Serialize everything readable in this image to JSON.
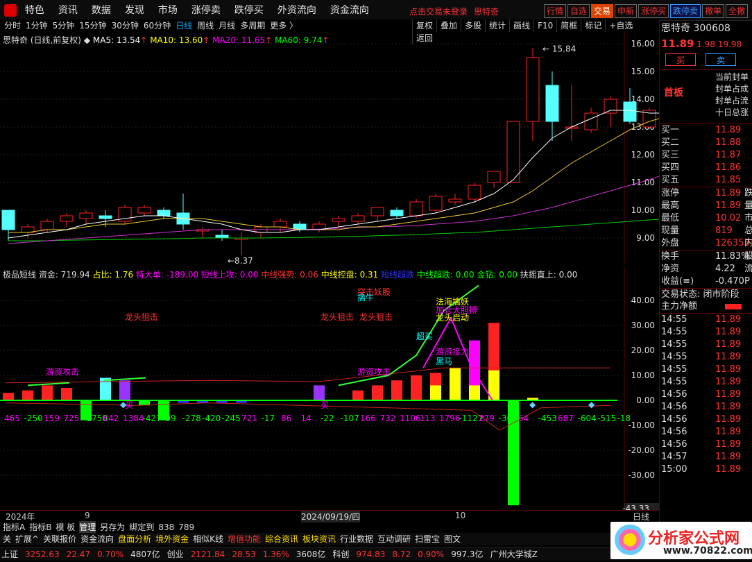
{
  "menu": [
    "特色",
    "资讯",
    "数据",
    "发现",
    "市场",
    "涨停卖",
    "跌停买",
    "外资流向",
    "资金流向"
  ],
  "topRight": {
    "login": "点击交易未登录",
    "stock": "思特奇",
    "buttons": [
      "行情",
      "自选",
      "交易",
      "申新",
      "涨停买",
      "跌停卖",
      "撤单",
      "全撤"
    ]
  },
  "periods": [
    "分时",
    "1分钟",
    "5分钟",
    "15分钟",
    "30分钟",
    "60分钟",
    "日线",
    "周线",
    "月线",
    "多周期",
    "更多 〉"
  ],
  "activePeriod": "日线",
  "tools": [
    "复权",
    "叠加",
    "多股",
    "统计",
    "画线",
    "F10",
    "简框",
    "标记",
    "+自选",
    "返回"
  ],
  "main": {
    "title": "思特奇 (日线,前复权)",
    "ma5": "MA5: 13.54",
    "ma10": "MA10: 13.60",
    "ma20": "MA20: 11.65",
    "ma60": "MA60: 9.74",
    "high": "15.84",
    "low": "8.37",
    "yticks": [
      "16.00",
      "15.00",
      "14.00",
      "13.00",
      "12.00",
      "11.00",
      "10.00",
      "9.00"
    ]
  },
  "sub": {
    "name": "极品短线",
    "indicators": [
      {
        "t": "资金: 719.94",
        "c": "#ddd"
      },
      {
        "t": "占比: 1.76",
        "c": "#ff0"
      },
      {
        "t": "特大单: -189.00",
        "c": "#f0f"
      },
      {
        "t": "短线上攻: 0.00",
        "c": "#f0f"
      },
      {
        "t": "中线强势: 0.06",
        "c": "#f33"
      },
      {
        "t": "中线控盘: 0.31",
        "c": "#ff0"
      },
      {
        "t": "短线超跌",
        "c": "#33f"
      },
      {
        "t": "中线超跌: 0.00",
        "c": "#0f0"
      },
      {
        "t": "金钻: 0.00",
        "c": "#0f0"
      },
      {
        "t": "扶摇直上: 0.00",
        "c": "#ddd"
      }
    ],
    "yticks": [
      "40.00",
      "30.00",
      "20.00",
      "10.00",
      "0.00",
      "-10.00",
      "-20.00",
      "-30.00"
    ],
    "minLabel": "-43.33",
    "labels": [
      {
        "t": "龙头狙击",
        "x": 180,
        "y": 76,
        "c": "#f33"
      },
      {
        "t": "龙头狙击",
        "x": 462,
        "y": 76,
        "c": "#f33"
      },
      {
        "t": "龙头狙击",
        "x": 518,
        "y": 76,
        "c": "#f33"
      },
      {
        "t": "突击妖股",
        "x": 515,
        "y": 40,
        "c": "#f33"
      },
      {
        "t": "擒牛",
        "x": 515,
        "y": 48,
        "c": "#0ff"
      },
      {
        "t": "法海擒妖",
        "x": 628,
        "y": 54,
        "c": "#ff0"
      },
      {
        "t": "加仓大胆搏",
        "x": 628,
        "y": 66,
        "c": "#f0f"
      },
      {
        "t": "龙头启动",
        "x": 628,
        "y": 77,
        "c": "#ff0"
      },
      {
        "t": "超买",
        "x": 600,
        "y": 104,
        "c": "#0ff"
      },
      {
        "t": "游资接力",
        "x": 628,
        "y": 126,
        "c": "#f0f"
      },
      {
        "t": "黑马",
        "x": 628,
        "y": 140,
        "c": "#0ff"
      },
      {
        "t": "游资攻击",
        "x": 66,
        "y": 155,
        "c": "#f0f"
      },
      {
        "t": "游资攻击",
        "x": 515,
        "y": 155,
        "c": "#f0f"
      },
      {
        "t": "买",
        "x": 180,
        "y": 203,
        "c": "#f0f"
      },
      {
        "t": "买",
        "x": 462,
        "y": 203,
        "c": "#f0f"
      }
    ],
    "values": [
      "465",
      "-250",
      "159",
      "725",
      "-1750",
      "642",
      "1384",
      "-427",
      "-99",
      "-278",
      "-420",
      "-245",
      "721",
      "-17",
      "86",
      "14",
      "-22",
      "-107",
      "166",
      "732",
      "1106",
      "113",
      "1796",
      "-1127",
      "279",
      "-360",
      "64",
      "-453",
      "687",
      "-604",
      "-515",
      "-18"
    ]
  },
  "xaxis": {
    "year": "2024年",
    "m9": "9",
    "date": "2024/09/19/四",
    "m10": "10",
    "period": "日线"
  },
  "tabs": [
    "指标A",
    "指标B",
    "模 板",
    "管理",
    "另存为",
    "绑定到",
    "838",
    "789"
  ],
  "funcs": [
    "关",
    "扩展^",
    "关联报价",
    "资金流向",
    "盘面分析",
    "境外资金",
    "相似K线",
    "增值功能",
    "综合资讯",
    "板块资讯",
    "行业数据",
    "互动调研",
    "扫雷宝",
    "图文"
  ],
  "status": [
    {
      "t": "上证",
      "c": "#ddd"
    },
    {
      "t": "3252.63",
      "c": "#f33"
    },
    {
      "t": "22.47",
      "c": "#f33"
    },
    {
      "t": "0.70%",
      "c": "#f33"
    },
    {
      "t": "4807亿",
      "c": "#ddd"
    },
    {
      "t": "创业",
      "c": "#ddd"
    },
    {
      "t": "2121.84",
      "c": "#f33"
    },
    {
      "t": "28.53",
      "c": "#f33"
    },
    {
      "t": "1.36%",
      "c": "#f33"
    },
    {
      "t": "3608亿",
      "c": "#ddd"
    },
    {
      "t": "科创",
      "c": "#ddd"
    },
    {
      "t": "974.83",
      "c": "#f33"
    },
    {
      "t": "8.72",
      "c": "#f33"
    },
    {
      "t": "0.90%",
      "c": "#f33"
    },
    {
      "t": "997.3亿",
      "c": "#ddd"
    },
    {
      "t": "广州大学城Z",
      "c": "#ddd"
    }
  ],
  "quote": {
    "name": "思特奇",
    "code": "300608",
    "price": "11.89",
    "chg": "1.98",
    "pct": "19.98",
    "buy": "买",
    "sell": "卖",
    "board": "首板",
    "notes": [
      "当前封单",
      "封单占成",
      "封单占流",
      "十日总涨"
    ],
    "bids": [
      {
        "l": "买一",
        "v": "11.89"
      },
      {
        "l": "买二",
        "v": "11.88"
      },
      {
        "l": "买三",
        "v": "11.87"
      },
      {
        "l": "买四",
        "v": "11.86"
      },
      {
        "l": "买五",
        "v": "11.85"
      }
    ],
    "stats": [
      {
        "l": "涨停",
        "v": "11.89",
        "r": "跌"
      },
      {
        "l": "最高",
        "v": "11.89",
        "r": "量"
      },
      {
        "l": "最低",
        "v": "10.02",
        "r": "市"
      },
      {
        "l": "现量",
        "v": "819",
        "r": "总"
      },
      {
        "l": "外盘",
        "v": "126353",
        "r": "内"
      }
    ],
    "stats2": [
      {
        "l": "换手",
        "v": "11.83%",
        "r": "股"
      },
      {
        "l": "净资",
        "v": "4.22",
        "r": "流"
      },
      {
        "l": "收益(≡)",
        "v": "-0.470",
        "r": "P"
      }
    ],
    "tradeState": "交易状态: 闭市阶段",
    "netflow": "主力净额",
    "ticks": [
      {
        "t": "14:55",
        "p": "11.89"
      },
      {
        "t": "14:55",
        "p": "11.89"
      },
      {
        "t": "14:55",
        "p": "11.89"
      },
      {
        "t": "14:55",
        "p": "11.89"
      },
      {
        "t": "14:55",
        "p": "11.89"
      },
      {
        "t": "14:55",
        "p": "11.89"
      },
      {
        "t": "14:56",
        "p": "11.89"
      },
      {
        "t": "14:56",
        "p": "11.89"
      },
      {
        "t": "14:56",
        "p": "11.89"
      },
      {
        "t": "14:56",
        "p": "11.89"
      },
      {
        "t": "14:56",
        "p": "11.89"
      },
      {
        "t": "14:57",
        "p": "11.89"
      },
      {
        "t": "15:00",
        "p": "11.89"
      }
    ]
  },
  "badge": "分析家公式网",
  "badgeUrl": "www.70822.com"
}
